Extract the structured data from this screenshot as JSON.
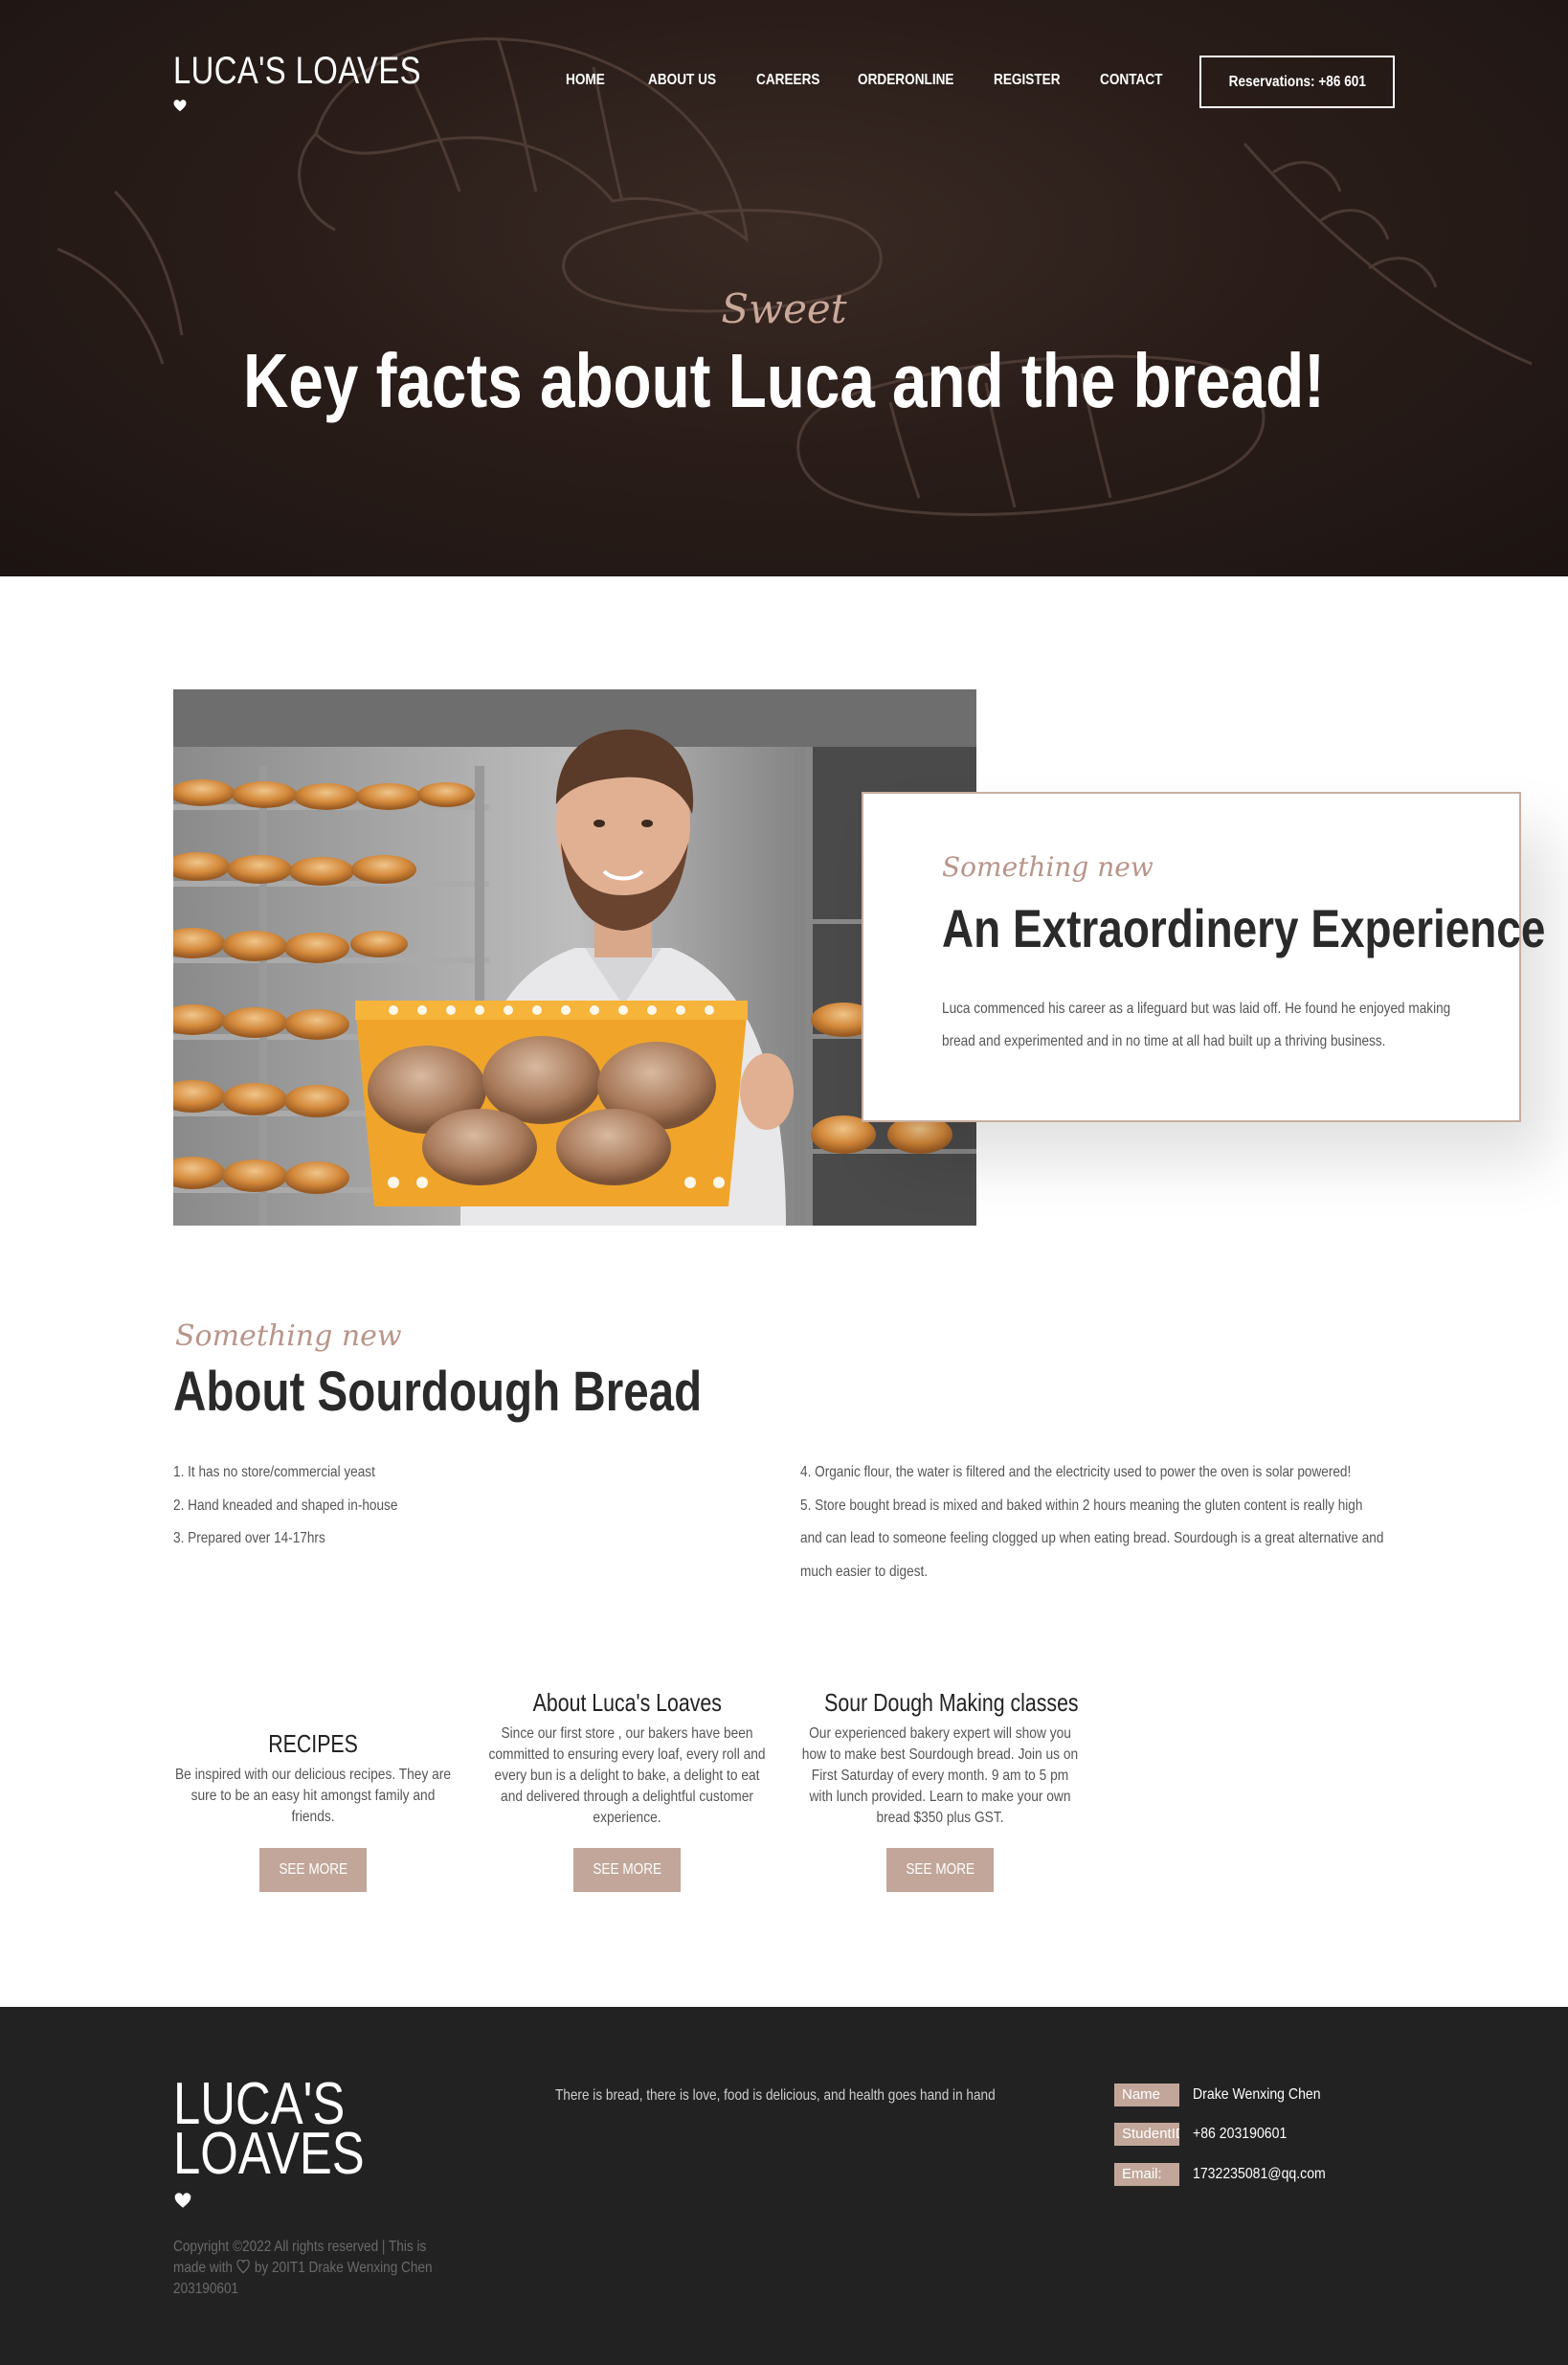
{
  "header": {
    "logo": "LUCA'S LOAVES",
    "nav": [
      "HOME",
      "ABOUT US",
      "CAREERS",
      "ORDERONLINE",
      "REGISTER",
      "CONTACT"
    ],
    "reservations": "Reservations: +86 601"
  },
  "hero": {
    "script": "Sweet",
    "title": "Key facts about Luca and the bread!"
  },
  "experience": {
    "script": "Something new",
    "title": "An Extraordinery Experience",
    "text": "Luca commenced his career as a lifeguard but was laid off. He found he enjoyed making bread and experimented and in no time at all had built up a thriving business."
  },
  "sourdough": {
    "script": "Something new",
    "title": "About Sourdough Bread",
    "left": [
      "1. It has no store/commercial yeast",
      "2. Hand kneaded and shaped in-house",
      "3. Prepared over 14-17hrs"
    ],
    "right": [
      "4. Organic flour, the water is filtered and the electricity used to power the oven is solar powered!",
      "5. Store bought bread is mixed and baked within 2 hours meaning the gluten content is really high and can lead to someone feeling clogged up when eating bread. Sourdough is a great alternative and much easier to digest."
    ]
  },
  "cards": [
    {
      "title": "RECIPES",
      "text": "Be inspired with our delicious recipes. They are sure to be an easy hit amongst family and friends.",
      "button": "SEE MORE"
    },
    {
      "title": "About Luca's Loaves",
      "text": "Since our first store , our bakers have been committed to ensuring every loaf, every roll and every bun is a delight to bake, a delight to eat and delivered through a delightful customer experience.",
      "button": "SEE MORE"
    },
    {
      "title": "Sour Dough Making classes",
      "text": "Our experienced bakery expert will show you how to make best Sourdough bread. Join us on First Saturday of every month. 9 am to 5 pm with lunch provided. Learn to make your own bread $350 plus GST.",
      "button": "SEE MORE"
    }
  ],
  "footer": {
    "logo_line1": "LUCA'S",
    "logo_line2": "LOAVES",
    "copyright_a": "Copyright ©2022 All rights reserved | This is made with",
    "copyright_b": "by 20IT1 Drake Wenxing Chen 203190601",
    "tagline": "There is bread, there is love, food is delicious, and health goes hand in hand",
    "info": [
      {
        "label": "Name",
        "value": "Drake Wenxing Chen"
      },
      {
        "label": "StudentID:",
        "value": "+86 203190601"
      },
      {
        "label": "Email:",
        "value": "1732235081@qq.com"
      }
    ]
  },
  "colors": {
    "accent": "#c2a69a",
    "hero_bg": "#2a1d19",
    "footer_bg": "#222222"
  }
}
